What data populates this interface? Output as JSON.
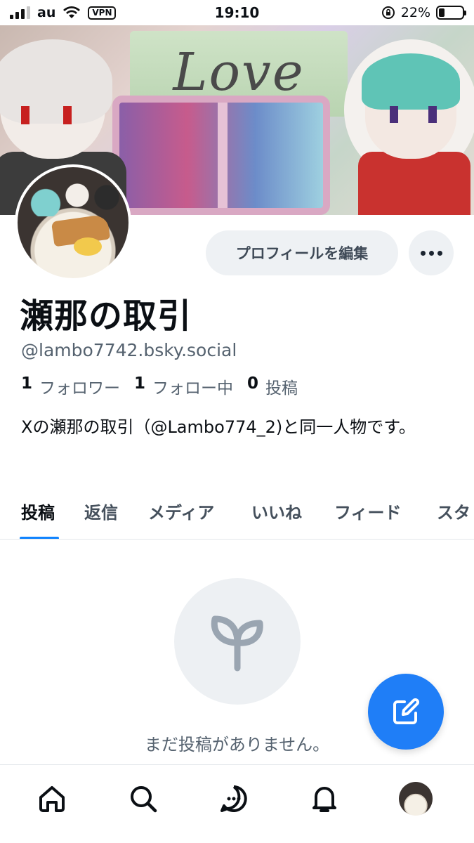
{
  "status_bar": {
    "carrier": "au",
    "vpn_label": "VPN",
    "time": "19:10",
    "battery_percent": "22%",
    "battery_level": 0.22
  },
  "profile": {
    "edit_button_label": "プロフィールを編集",
    "display_name": "瀬那の取引",
    "handle": "@lambo7742.bsky.social",
    "stats": [
      {
        "count": "1",
        "label": "フォロワー"
      },
      {
        "count": "1",
        "label": "フォロー中"
      },
      {
        "count": "0",
        "label": "投稿"
      }
    ],
    "bio": "Xの瀬那の取引（@Lambo774_2)と同一人物です。"
  },
  "banner": {
    "sign_text": "Love"
  },
  "tabs": [
    {
      "label": "投稿",
      "active": true
    },
    {
      "label": "返信"
    },
    {
      "label": "メディア"
    },
    {
      "label": "いいね"
    },
    {
      "label": "フィード"
    },
    {
      "label": "スタ"
    }
  ],
  "empty_state": {
    "icon": "sprout-icon",
    "text": "まだ投稿がありません。"
  },
  "fab": {
    "icon": "compose-icon"
  },
  "bottom_nav": [
    {
      "name": "home",
      "icon": "home-icon"
    },
    {
      "name": "search",
      "icon": "search-icon"
    },
    {
      "name": "messages",
      "icon": "chat-icon"
    },
    {
      "name": "notifications",
      "icon": "bell-icon"
    },
    {
      "name": "profile",
      "icon": "avatar"
    }
  ],
  "colors": {
    "accent": "#1083fe",
    "fab": "#1f7ef7",
    "muted_text": "#55626f",
    "button_bg": "#eef1f4"
  }
}
